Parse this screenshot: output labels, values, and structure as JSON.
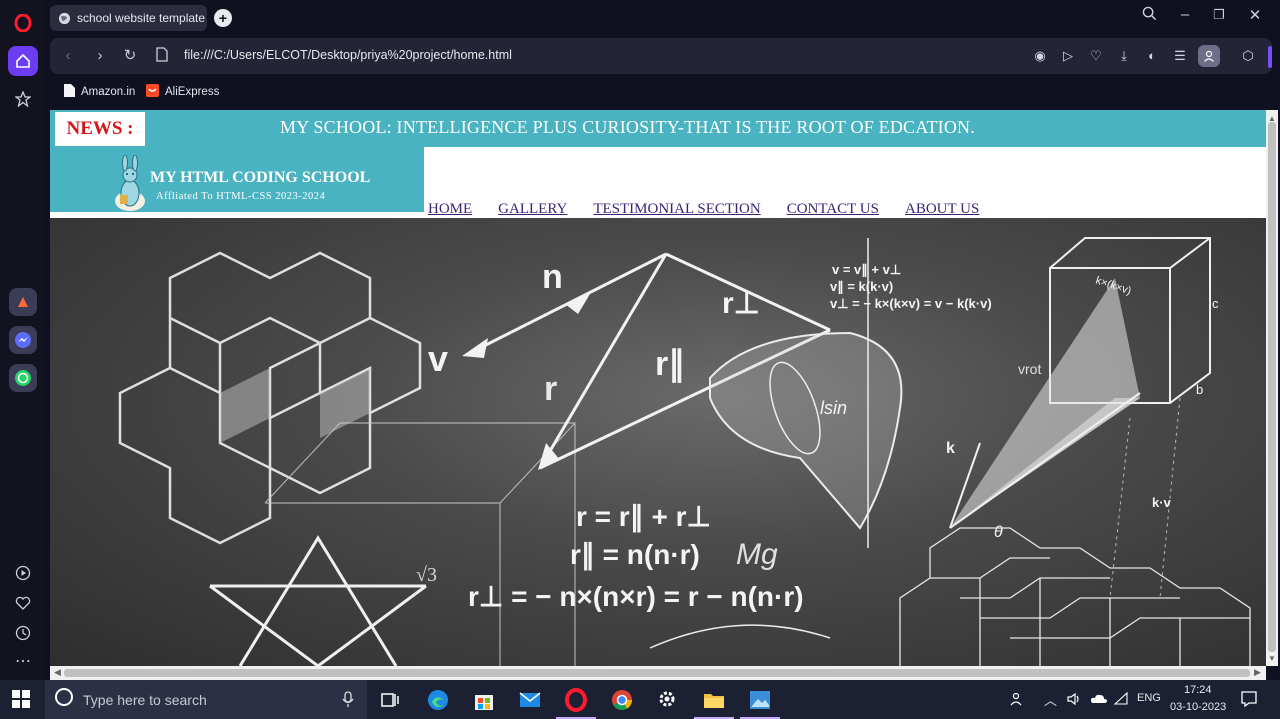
{
  "browser": {
    "tab_title": "school website template",
    "url": "file:///C:/Users/ELCOT/Desktop/priya%20project/home.html",
    "bookmarks": [
      "Amazon.in",
      "AliExpress"
    ]
  },
  "page": {
    "news_label": "NEWS :",
    "news_text": "MY SCHOOL: INTELLIGENCE PLUS CURIOSITY-THAT IS THE ROOT OF EDCATION.",
    "school_name": "MY HTML CODING SCHOOL",
    "school_sub": "Affliated To HTML-CSS 2023-2024",
    "nav": [
      "HOME",
      "GALLERY",
      "TESTIMONIAL SECTION",
      "CONTACT US",
      "ABOUT US"
    ],
    "chalk": {
      "n": "n",
      "v": "v",
      "r": "r",
      "r_perp": "r⊥",
      "r_par": "r∥",
      "v_eq1": "v = v∥ + v⊥",
      "v_eq2": "v∥ = k(k·v)",
      "v_eq3": "v⊥ = − k×(k×v) = v − k(k·v)",
      "r_eq1": "r = r∥ + r⊥",
      "r_eq2": "r∥ = n(n·r)",
      "r_eq3": "r⊥ = − n×(n×r) = r − n(n·r)",
      "mg": "Mg",
      "sqrt3": "√3",
      "lsin": "lsin",
      "theta": "θ",
      "kv": "k·v",
      "k": "k",
      "b": "b",
      "c": "c",
      "kxv": "k×(k×v)",
      "vrot": "vrot"
    }
  },
  "taskbar": {
    "search_placeholder": "Type here to search",
    "lang": "ENG",
    "time": "17:24",
    "date": "03-10-2023"
  }
}
